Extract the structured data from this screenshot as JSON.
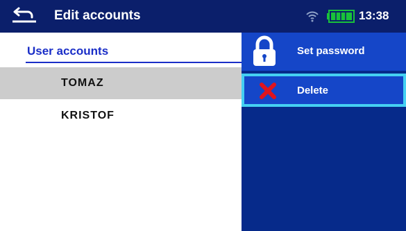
{
  "header": {
    "title": "Edit accounts",
    "time": "13:38",
    "back_icon": "back-arrow-icon",
    "wifi_icon": "wifi-icon",
    "battery_icon": "battery-icon",
    "battery_level": 1.0
  },
  "accounts": {
    "heading": "User accounts",
    "items": [
      {
        "label": "TOMAZ",
        "selected": true
      },
      {
        "label": "KRISTOF",
        "selected": false
      }
    ]
  },
  "menu": {
    "items": [
      {
        "label": "Set password",
        "icon": "lock-icon"
      },
      {
        "label": "Delete",
        "icon": "delete-x-icon",
        "active": true
      }
    ]
  },
  "colors": {
    "header_bg": "#0b1f6b",
    "menu_bg": "#062a8a",
    "menu_item_bg": "#1546c8",
    "focus_border": "#45d0f2",
    "heading": "#1a2ec7",
    "delete_icon": "#e0141e"
  }
}
